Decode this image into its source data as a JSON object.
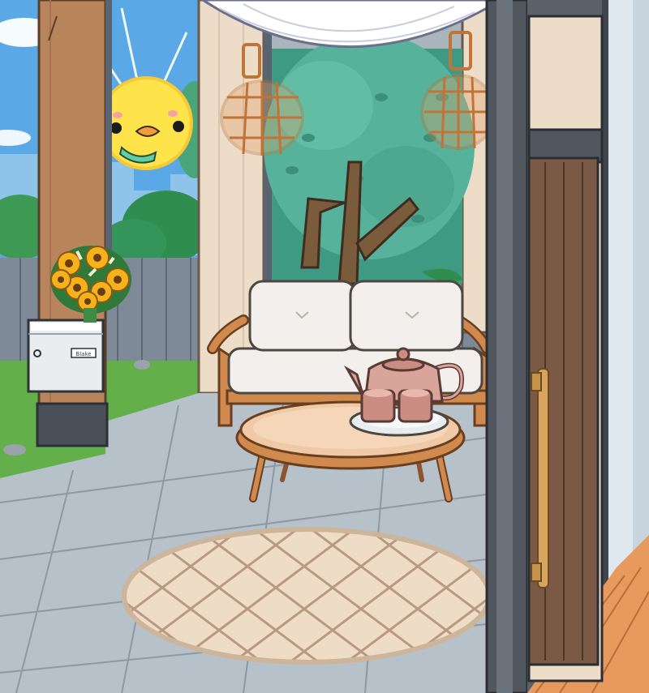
{
  "scene": {
    "mailbox_label": "Blake",
    "colors": {
      "sky": "#5aa9e6",
      "wood_post": "#b8845c",
      "floor_tile": "#b7c1ca",
      "door_wood": "#7a5a46",
      "grass": "#63b04a",
      "rug": "#efdcc6"
    },
    "items": [
      {
        "key": "sun",
        "icon": "smiling-duck-sun-icon"
      },
      {
        "key": "lanterns",
        "icon": "rattan-lantern-icon"
      },
      {
        "key": "sofa",
        "icon": "rattan-sofa-icon"
      },
      {
        "key": "coffee_table",
        "icon": "round-table-icon"
      },
      {
        "key": "teapot",
        "icon": "teapot-icon"
      },
      {
        "key": "flowers",
        "icon": "sunflower-bouquet-icon"
      },
      {
        "key": "mailbox",
        "icon": "mailbox-icon"
      },
      {
        "key": "rug",
        "icon": "round-rug-icon"
      },
      {
        "key": "door",
        "icon": "wooden-door-icon"
      }
    ]
  }
}
